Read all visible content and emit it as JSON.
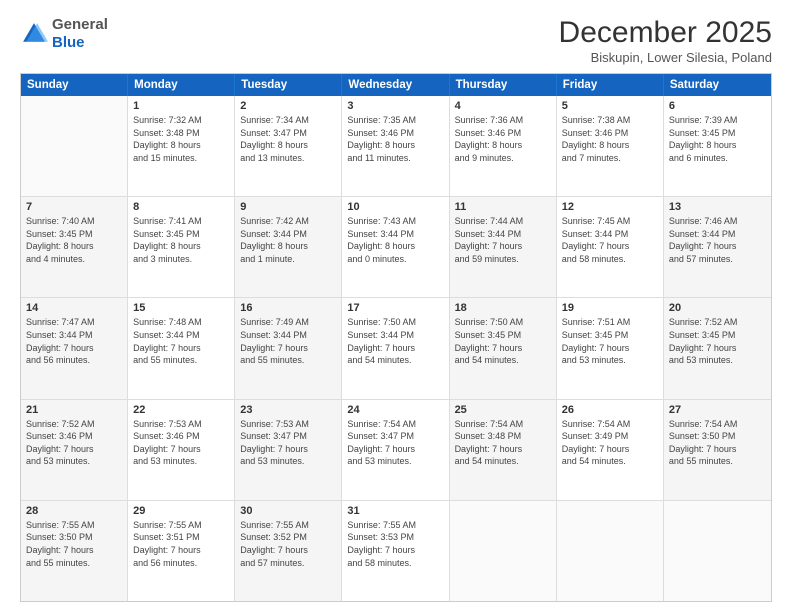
{
  "header": {
    "logo_general": "General",
    "logo_blue": "Blue",
    "month_title": "December 2025",
    "location": "Biskupin, Lower Silesia, Poland"
  },
  "days_of_week": [
    "Sunday",
    "Monday",
    "Tuesday",
    "Wednesday",
    "Thursday",
    "Friday",
    "Saturday"
  ],
  "rows": [
    [
      {
        "num": "",
        "text": "",
        "empty": true
      },
      {
        "num": "1",
        "text": "Sunrise: 7:32 AM\nSunset: 3:48 PM\nDaylight: 8 hours\nand 15 minutes."
      },
      {
        "num": "2",
        "text": "Sunrise: 7:34 AM\nSunset: 3:47 PM\nDaylight: 8 hours\nand 13 minutes."
      },
      {
        "num": "3",
        "text": "Sunrise: 7:35 AM\nSunset: 3:46 PM\nDaylight: 8 hours\nand 11 minutes."
      },
      {
        "num": "4",
        "text": "Sunrise: 7:36 AM\nSunset: 3:46 PM\nDaylight: 8 hours\nand 9 minutes."
      },
      {
        "num": "5",
        "text": "Sunrise: 7:38 AM\nSunset: 3:46 PM\nDaylight: 8 hours\nand 7 minutes."
      },
      {
        "num": "6",
        "text": "Sunrise: 7:39 AM\nSunset: 3:45 PM\nDaylight: 8 hours\nand 6 minutes."
      }
    ],
    [
      {
        "num": "7",
        "text": "Sunrise: 7:40 AM\nSunset: 3:45 PM\nDaylight: 8 hours\nand 4 minutes.",
        "shaded": true
      },
      {
        "num": "8",
        "text": "Sunrise: 7:41 AM\nSunset: 3:45 PM\nDaylight: 8 hours\nand 3 minutes."
      },
      {
        "num": "9",
        "text": "Sunrise: 7:42 AM\nSunset: 3:44 PM\nDaylight: 8 hours\nand 1 minute.",
        "shaded": true
      },
      {
        "num": "10",
        "text": "Sunrise: 7:43 AM\nSunset: 3:44 PM\nDaylight: 8 hours\nand 0 minutes."
      },
      {
        "num": "11",
        "text": "Sunrise: 7:44 AM\nSunset: 3:44 PM\nDaylight: 7 hours\nand 59 minutes.",
        "shaded": true
      },
      {
        "num": "12",
        "text": "Sunrise: 7:45 AM\nSunset: 3:44 PM\nDaylight: 7 hours\nand 58 minutes."
      },
      {
        "num": "13",
        "text": "Sunrise: 7:46 AM\nSunset: 3:44 PM\nDaylight: 7 hours\nand 57 minutes.",
        "shaded": true
      }
    ],
    [
      {
        "num": "14",
        "text": "Sunrise: 7:47 AM\nSunset: 3:44 PM\nDaylight: 7 hours\nand 56 minutes.",
        "shaded": true
      },
      {
        "num": "15",
        "text": "Sunrise: 7:48 AM\nSunset: 3:44 PM\nDaylight: 7 hours\nand 55 minutes."
      },
      {
        "num": "16",
        "text": "Sunrise: 7:49 AM\nSunset: 3:44 PM\nDaylight: 7 hours\nand 55 minutes.",
        "shaded": true
      },
      {
        "num": "17",
        "text": "Sunrise: 7:50 AM\nSunset: 3:44 PM\nDaylight: 7 hours\nand 54 minutes."
      },
      {
        "num": "18",
        "text": "Sunrise: 7:50 AM\nSunset: 3:45 PM\nDaylight: 7 hours\nand 54 minutes.",
        "shaded": true
      },
      {
        "num": "19",
        "text": "Sunrise: 7:51 AM\nSunset: 3:45 PM\nDaylight: 7 hours\nand 53 minutes."
      },
      {
        "num": "20",
        "text": "Sunrise: 7:52 AM\nSunset: 3:45 PM\nDaylight: 7 hours\nand 53 minutes.",
        "shaded": true
      }
    ],
    [
      {
        "num": "21",
        "text": "Sunrise: 7:52 AM\nSunset: 3:46 PM\nDaylight: 7 hours\nand 53 minutes.",
        "shaded": true
      },
      {
        "num": "22",
        "text": "Sunrise: 7:53 AM\nSunset: 3:46 PM\nDaylight: 7 hours\nand 53 minutes."
      },
      {
        "num": "23",
        "text": "Sunrise: 7:53 AM\nSunset: 3:47 PM\nDaylight: 7 hours\nand 53 minutes.",
        "shaded": true
      },
      {
        "num": "24",
        "text": "Sunrise: 7:54 AM\nSunset: 3:47 PM\nDaylight: 7 hours\nand 53 minutes."
      },
      {
        "num": "25",
        "text": "Sunrise: 7:54 AM\nSunset: 3:48 PM\nDaylight: 7 hours\nand 54 minutes.",
        "shaded": true
      },
      {
        "num": "26",
        "text": "Sunrise: 7:54 AM\nSunset: 3:49 PM\nDaylight: 7 hours\nand 54 minutes."
      },
      {
        "num": "27",
        "text": "Sunrise: 7:54 AM\nSunset: 3:50 PM\nDaylight: 7 hours\nand 55 minutes.",
        "shaded": true
      }
    ],
    [
      {
        "num": "28",
        "text": "Sunrise: 7:55 AM\nSunset: 3:50 PM\nDaylight: 7 hours\nand 55 minutes.",
        "shaded": true
      },
      {
        "num": "29",
        "text": "Sunrise: 7:55 AM\nSunset: 3:51 PM\nDaylight: 7 hours\nand 56 minutes."
      },
      {
        "num": "30",
        "text": "Sunrise: 7:55 AM\nSunset: 3:52 PM\nDaylight: 7 hours\nand 57 minutes.",
        "shaded": true
      },
      {
        "num": "31",
        "text": "Sunrise: 7:55 AM\nSunset: 3:53 PM\nDaylight: 7 hours\nand 58 minutes."
      },
      {
        "num": "",
        "text": "",
        "empty": true
      },
      {
        "num": "",
        "text": "",
        "empty": true
      },
      {
        "num": "",
        "text": "",
        "empty": true
      }
    ]
  ]
}
